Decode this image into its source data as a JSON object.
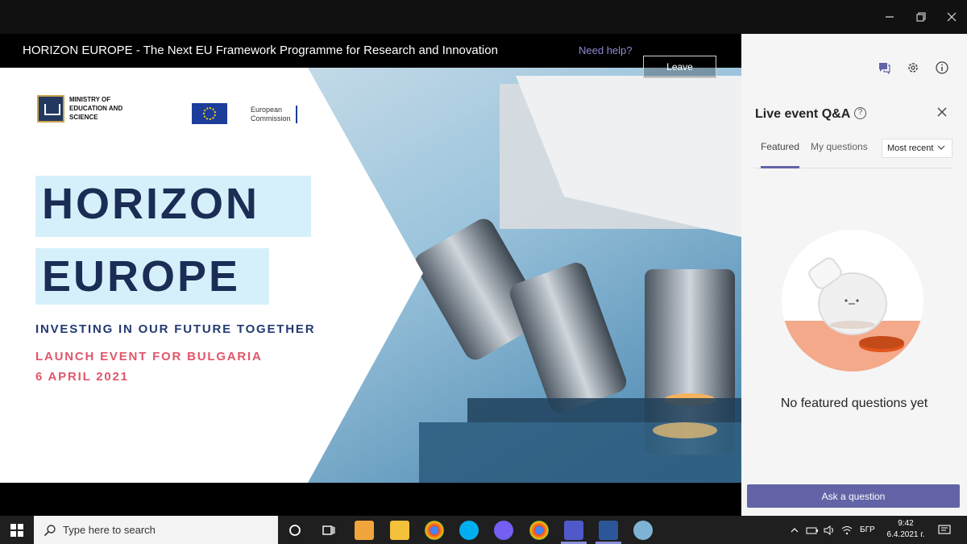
{
  "window": {
    "minimize_icon": "minimize-icon",
    "restore_icon": "restore-icon",
    "close_icon": "close-icon"
  },
  "event": {
    "title": "HORIZON EUROPE - The Next EU Framework Programme for Research and Innovation",
    "help_label": "Need help?",
    "leave_label": "Leave"
  },
  "slide": {
    "org1": "MINISTRY OF EDUCATION AND SCIENCE",
    "org2_line1": "European",
    "org2_line2": "Commission",
    "headline1": "HORIZON",
    "headline2": "EUROPE",
    "tagline": "INVESTING IN OUR FUTURE TOGETHER",
    "launch": "LAUNCH EVENT FOR BULGARIA",
    "date": "6 APRIL 2021"
  },
  "panel": {
    "title": "Live event Q&A",
    "help_icon": "?",
    "tabs": [
      {
        "label": "Featured",
        "active": true
      },
      {
        "label": "My questions",
        "active": false
      }
    ],
    "sort": "Most recent",
    "empty_message": "No featured questions yet",
    "ask_button": "Ask a question",
    "accent": "#6264a7"
  },
  "taskbar": {
    "search_placeholder": "Type here to search",
    "language": "БГР",
    "time": "9:42",
    "date": "6.4.2021 г."
  }
}
